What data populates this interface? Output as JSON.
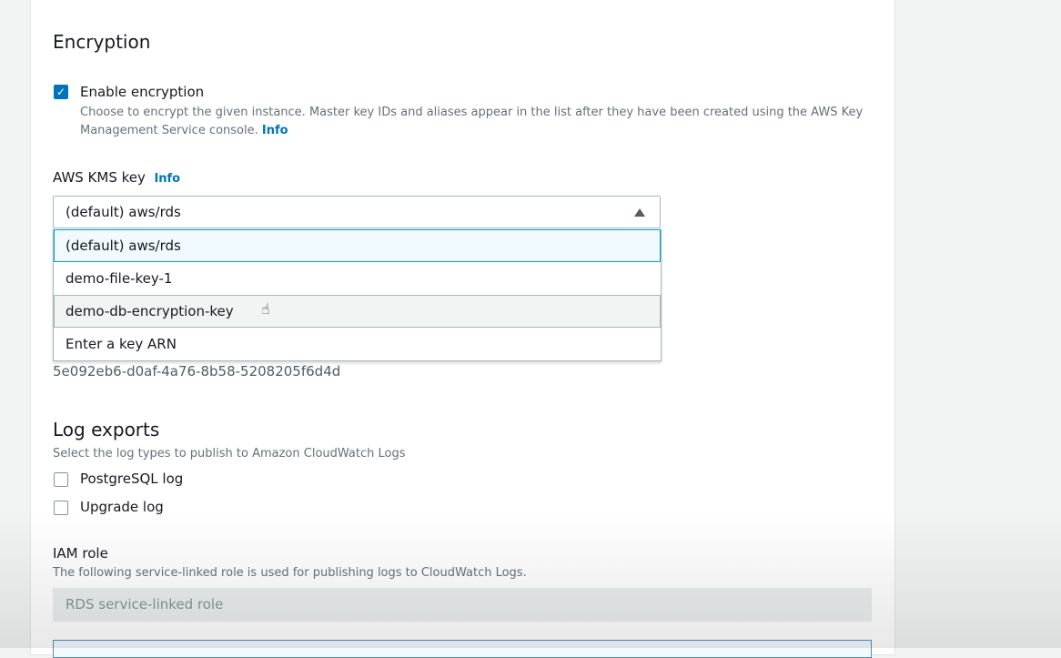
{
  "encryption": {
    "title": "Encryption",
    "enable_label": "Enable encryption",
    "enable_checked": true,
    "enable_desc": "Choose to encrypt the given instance. Master key IDs and aliases appear in the list after they have been created using the AWS Key Management Service console.",
    "info": "Info",
    "kms_label": "AWS KMS key",
    "kms_info": "Info",
    "kms_selected": "(default) aws/rds",
    "kms_options": [
      "(default) aws/rds",
      "demo-file-key-1",
      "demo-db-encryption-key",
      "Enter a key ARN"
    ],
    "key_id": "5e092eb6-d0af-4a76-8b58-5208205f6d4d"
  },
  "log_exports": {
    "title": "Log exports",
    "desc": "Select the log types to publish to Amazon CloudWatch Logs",
    "options": [
      "PostgreSQL log",
      "Upgrade log"
    ]
  },
  "iam": {
    "label": "IAM role",
    "desc": "The following service-linked role is used for publishing logs to CloudWatch Logs.",
    "value": "RDS service-linked role"
  }
}
